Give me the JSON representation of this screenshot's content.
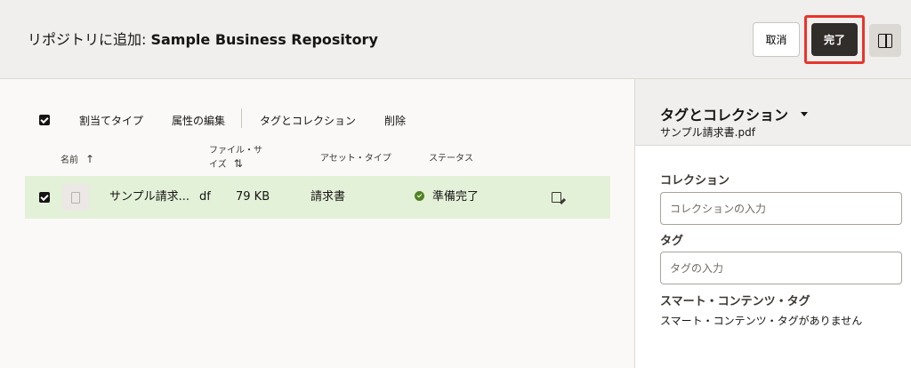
{
  "header": {
    "title_prefix": "リポジトリに追加: ",
    "title_name": "Sample Business Repository",
    "cancel_label": "取消",
    "done_label": "完了",
    "panel_toggle_icon": "panel-right-icon"
  },
  "toolbar": {
    "assign_type": "割当てタイプ",
    "edit_attributes": "属性の編集",
    "tags_collections": "タグとコレクション",
    "delete": "削除"
  },
  "columns": {
    "name": "名前",
    "size_line1": "ファイル・サ",
    "size_line2": "イズ",
    "asset_type": "アセット・タイプ",
    "status": "ステータス"
  },
  "rows": [
    {
      "name": "サンプル請求...",
      "ext": "df",
      "size": "79 KB",
      "asset_type": "請求書",
      "status": "準備完了",
      "status_color": "#508223",
      "selected": true
    }
  ],
  "side_panel": {
    "title": "タグとコレクション",
    "subtitle": "サンプル請求書.pdf",
    "collection_label": "コレクション",
    "collection_placeholder": "コレクションの入力",
    "tag_label": "タグ",
    "tag_placeholder": "タグの入力",
    "smart_label": "スマート・コンテンツ・タグ",
    "smart_empty": "スマート・コンテンツ・タグがありません"
  },
  "colors": {
    "selected_row": "#e4f1d9",
    "highlight_border": "#e8352b",
    "primary_button": "#312d2a"
  }
}
